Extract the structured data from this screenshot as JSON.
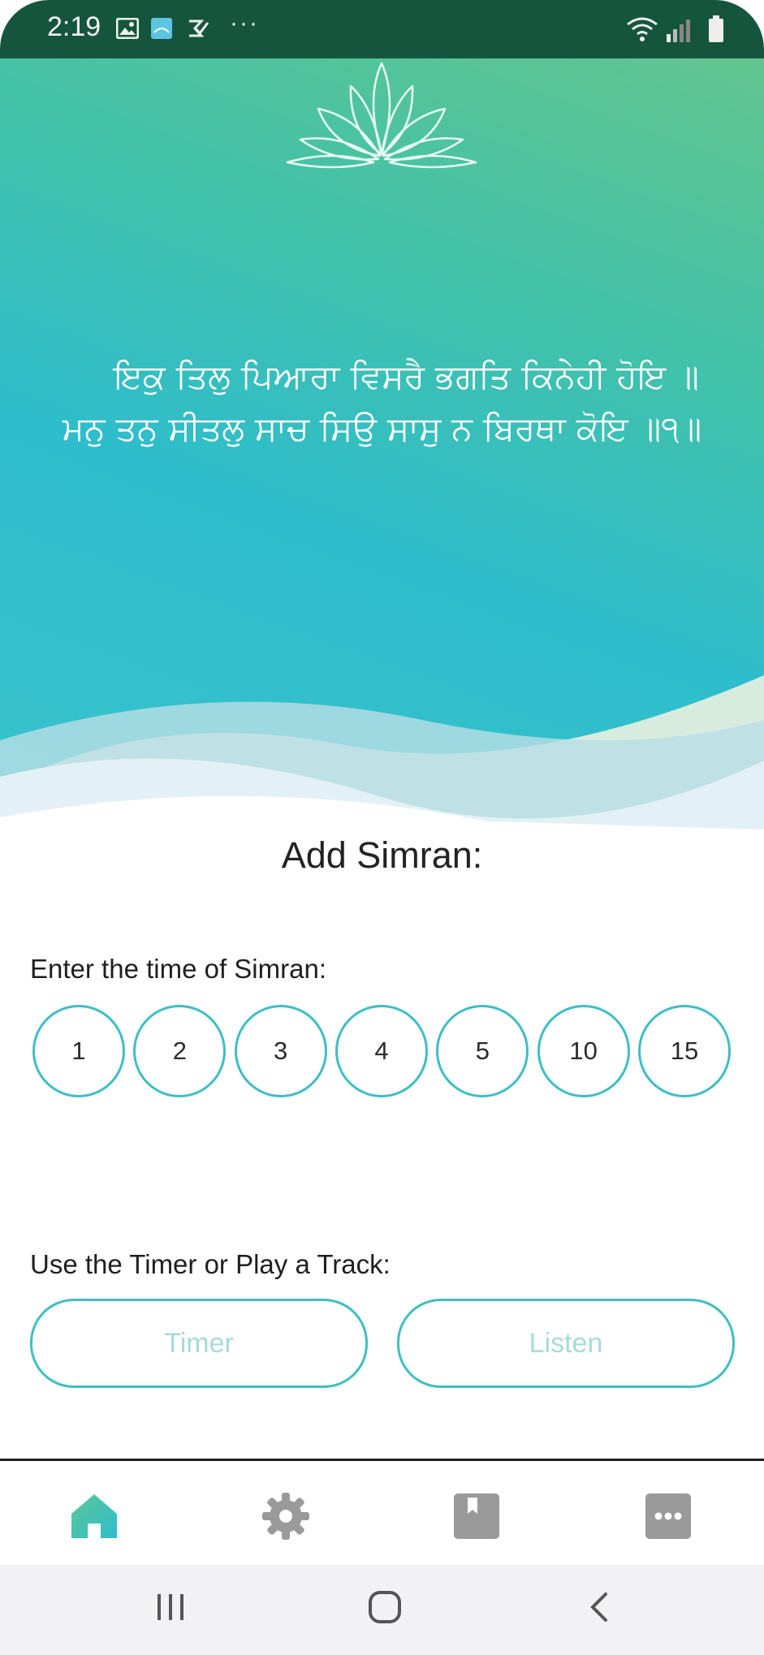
{
  "status_bar": {
    "time": "2:19",
    "icons": [
      "image-icon",
      "app-icon",
      "check-icon",
      "more-dots-icon",
      "wifi-icon",
      "signal-icon",
      "battery-icon"
    ],
    "more": "···"
  },
  "hero": {
    "logo": "lotus-icon",
    "verse_line1": "ਇਕੁ ਤਿਲੁ ਪਿਆਰਾ ਵਿਸਰੈ ਭਗਤਿ ਕਿਨੇਹੀ ਹੋਇ ॥",
    "verse_line2": "ਮਨੁ ਤਨੁ ਸੀਤਲੁ ਸਾਚ ਸਿਉ ਸਾਸੁ ਨ ਬਿਰਥਾ ਕੋਇ ॥੧॥"
  },
  "main": {
    "title": "Add Simran:",
    "time_label": "Enter the time of Simran:",
    "time_options": [
      "1",
      "2",
      "3",
      "4",
      "5",
      "10",
      "15"
    ],
    "mode_label": "Use the Timer or Play a Track:",
    "timer_button": "Timer",
    "listen_button": "Listen"
  },
  "bottom_nav": {
    "items": [
      "home-icon",
      "settings-icon",
      "bookmark-icon",
      "more-icon"
    ],
    "active": "home-icon"
  },
  "system_nav": [
    "recents-icon",
    "home-circle-icon",
    "back-icon"
  ],
  "colors": {
    "status_bar": "#15553e",
    "accent": "#3ebec6",
    "button_text": "#a6dcd6",
    "nav_inactive": "#9a9a9a"
  }
}
